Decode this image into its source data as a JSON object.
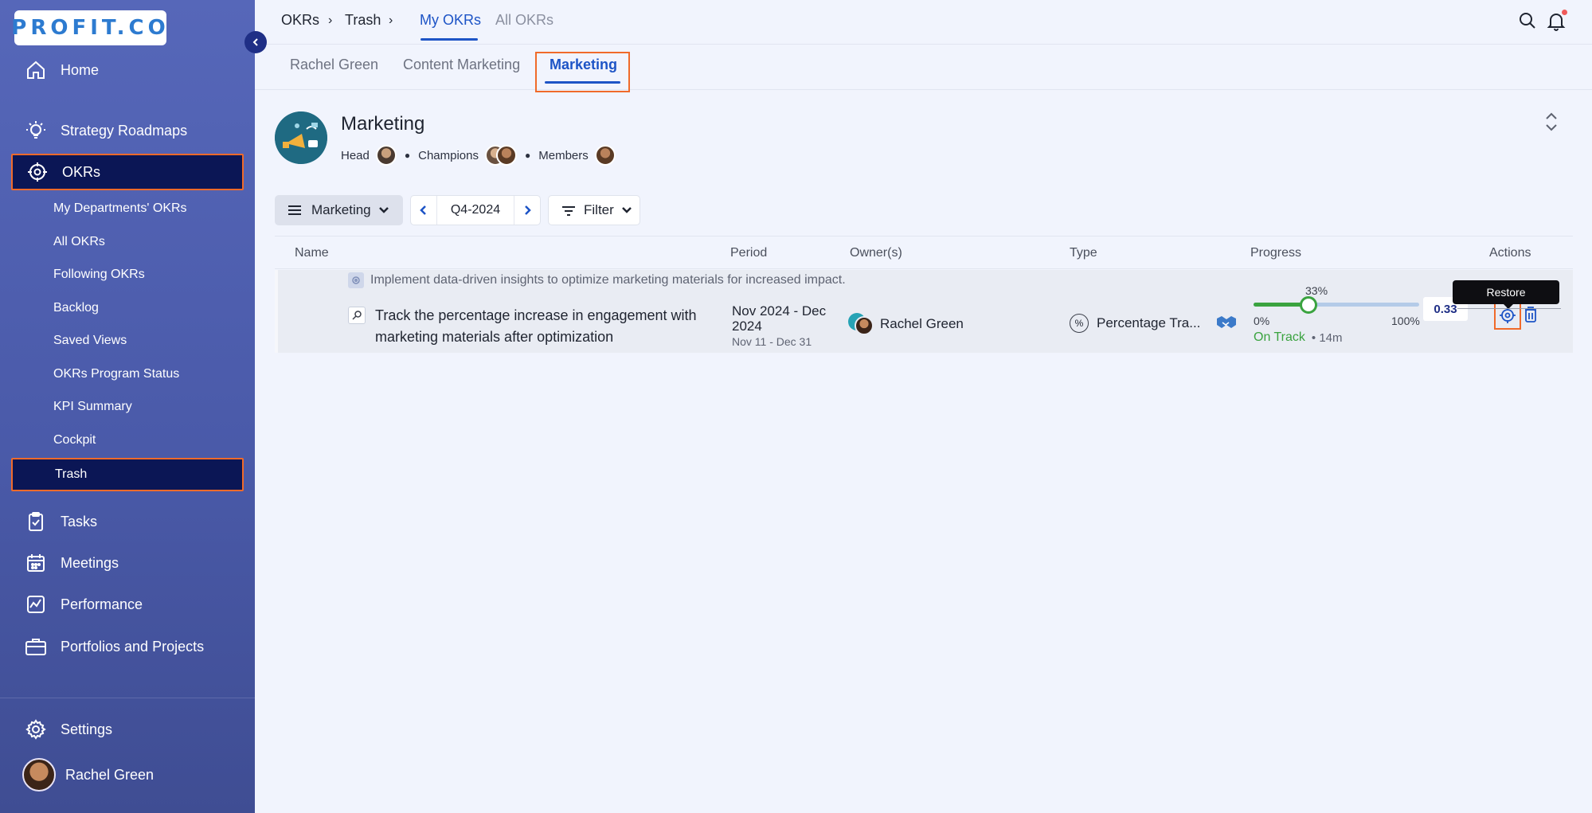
{
  "brand": {
    "logo_text": "PROFIT.CO"
  },
  "sidebar": {
    "items": [
      {
        "label": "Home",
        "icon": "home-icon"
      },
      {
        "label": "Strategy Roadmaps",
        "icon": "bulb-icon"
      },
      {
        "label": "OKRs",
        "icon": "target-icon",
        "active": true
      },
      {
        "label": "Tasks",
        "icon": "clipboard-icon"
      },
      {
        "label": "Meetings",
        "icon": "calendar-icon"
      },
      {
        "label": "Performance",
        "icon": "chart-icon"
      },
      {
        "label": "Portfolios and Projects",
        "icon": "briefcase-icon"
      }
    ],
    "okr_subitems": [
      "My Departments' OKRs",
      "All OKRs",
      "Following OKRs",
      "Backlog",
      "Saved Views",
      "OKRs Program Status",
      "KPI Summary",
      "Cockpit",
      "Trash"
    ],
    "settings_label": "Settings",
    "user_name": "Rachel Green"
  },
  "topbar": {
    "breadcrumb": [
      "OKRs",
      "Trash"
    ],
    "tabs": [
      {
        "label": "My OKRs",
        "active": true
      },
      {
        "label": "All OKRs",
        "active": false
      }
    ]
  },
  "subtabs": [
    {
      "label": "Rachel Green"
    },
    {
      "label": "Content Marketing"
    },
    {
      "label": "Marketing",
      "active": true
    }
  ],
  "department": {
    "title": "Marketing",
    "head_label": "Head",
    "champions_label": "Champions",
    "members_label": "Members"
  },
  "controls": {
    "dept_selector": "Marketing",
    "quarter": "Q4-2024",
    "filter_label": "Filter"
  },
  "table": {
    "columns": [
      "Name",
      "Period",
      "Owner(s)",
      "Type",
      "Progress",
      "Actions"
    ],
    "rows": [
      {
        "objective": "Implement data-driven insights to optimize marketing materials for increased impact.",
        "key_result": "Track the percentage increase in engagement with marketing materials after optimization",
        "period_main": "Nov 2024 - Dec 2024",
        "period_sub": "Nov 11 - Dec 31",
        "owner": "Rachel Green",
        "type": "Percentage Tra...",
        "progress_percent_label": "33%",
        "progress_value": 0.33,
        "progress_min": "0%",
        "progress_max": "100%",
        "current_value": "0.33",
        "status": "On Track",
        "updated": "14m"
      }
    ]
  },
  "tooltip": {
    "label": "Restore"
  },
  "colors": {
    "accent": "#1d54c6",
    "highlight": "#f06a2a",
    "on_track": "#3aa33f",
    "sidebar_active": "#0b1655"
  }
}
